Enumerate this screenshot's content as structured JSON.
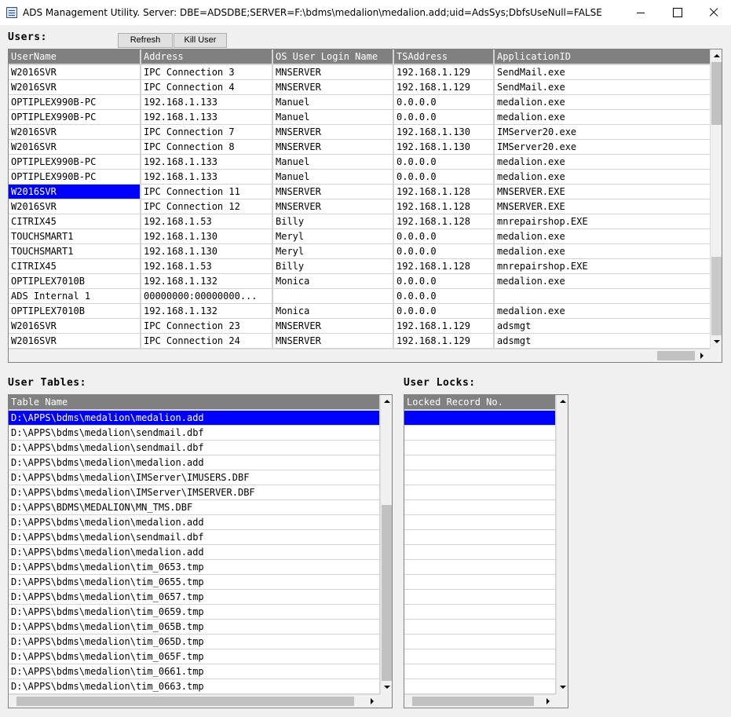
{
  "window": {
    "title": "ADS Management Utility. Server: DBE=ADSDBE;SERVER=F:\\bdms\\medalion\\medalion.add;uid=AdsSys;DbfsUseNull=FALSE"
  },
  "users": {
    "label": "Users:",
    "refresh_label": "Refresh",
    "kill_label": "Kill User",
    "columns": [
      "UserName",
      "Address",
      "OS User Login Name",
      "TSAddress",
      "ApplicationID"
    ],
    "selected_row": 7,
    "rows": [
      [
        "W2016SVR",
        "IPC Connection 3",
        "MNSERVER",
        "192.168.1.129",
        "SendMail.exe"
      ],
      [
        "W2016SVR",
        "IPC Connection 4",
        "MNSERVER",
        "192.168.1.129",
        "SendMail.exe"
      ],
      [
        "OPTIPLEX990B-PC",
        "192.168.1.133",
        "Manuel",
        "0.0.0.0",
        "medalion.exe"
      ],
      [
        "OPTIPLEX990B-PC",
        "192.168.1.133",
        "Manuel",
        "0.0.0.0",
        "medalion.exe"
      ],
      [
        "W2016SVR",
        "IPC Connection 7",
        "MNSERVER",
        "192.168.1.130",
        "IMServer20.exe"
      ],
      [
        "W2016SVR",
        "IPC Connection 8",
        "MNSERVER",
        "192.168.1.130",
        "IMServer20.exe"
      ],
      [
        "OPTIPLEX990B-PC",
        "192.168.1.133",
        "Manuel",
        "0.0.0.0",
        "medalion.exe"
      ],
      [
        "OPTIPLEX990B-PC",
        "192.168.1.133",
        "Manuel",
        "0.0.0.0",
        "medalion.exe"
      ],
      [
        "W2016SVR",
        "IPC Connection 11",
        "MNSERVER",
        "192.168.1.128",
        "MNSERVER.EXE"
      ],
      [
        "W2016SVR",
        "IPC Connection 12",
        "MNSERVER",
        "192.168.1.128",
        "MNSERVER.EXE"
      ],
      [
        "CITRIX45",
        "192.168.1.53",
        "Billy",
        "192.168.1.128",
        "mnrepairshop.EXE"
      ],
      [
        "TOUCHSMART1",
        "192.168.1.130",
        "Meryl",
        "0.0.0.0",
        "medalion.exe"
      ],
      [
        "TOUCHSMART1",
        "192.168.1.130",
        "Meryl",
        "0.0.0.0",
        "medalion.exe"
      ],
      [
        "CITRIX45",
        "192.168.1.53",
        "Billy",
        "192.168.1.128",
        "mnrepairshop.EXE"
      ],
      [
        "OPTIPLEX7010B",
        "192.168.1.132",
        "Monica",
        "0.0.0.0",
        "medalion.exe"
      ],
      [
        "ADS Internal 1",
        "00000000:00000000...",
        "",
        "0.0.0.0",
        ""
      ],
      [
        "OPTIPLEX7010B",
        "192.168.1.132",
        "Monica",
        "0.0.0.0",
        "medalion.exe"
      ],
      [
        "W2016SVR",
        "IPC Connection 23",
        "MNSERVER",
        "192.168.1.129",
        "adsmgt"
      ],
      [
        "W2016SVR",
        "IPC Connection 24",
        "MNSERVER",
        "192.168.1.129",
        "adsmgt"
      ]
    ]
  },
  "tables": {
    "label": "User Tables:",
    "column": "Table Name",
    "rows": [
      "D:\\APPS\\bdms\\medalion\\medalion.add",
      "D:\\APPS\\bdms\\medalion\\sendmail.dbf",
      "D:\\APPS\\bdms\\medalion\\sendmail.dbf",
      "D:\\APPS\\bdms\\medalion\\medalion.add",
      "D:\\APPS\\bdms\\medalion\\IMServer\\IMUSERS.DBF",
      "D:\\APPS\\bdms\\medalion\\IMServer\\IMSERVER.DBF",
      "D:\\APPS\\BDMS\\MEDALION\\MN_TMS.DBF",
      "D:\\APPS\\bdms\\medalion\\medalion.add",
      "D:\\APPS\\bdms\\medalion\\sendmail.dbf",
      "D:\\APPS\\bdms\\medalion\\medalion.add",
      "D:\\APPS\\bdms\\medalion\\tim_0653.tmp",
      "D:\\APPS\\bdms\\medalion\\tim_0655.tmp",
      "D:\\APPS\\bdms\\medalion\\tim_0657.tmp",
      "D:\\APPS\\bdms\\medalion\\tim_0659.tmp",
      "D:\\APPS\\bdms\\medalion\\tim_065B.tmp",
      "D:\\APPS\\bdms\\medalion\\tim_065D.tmp",
      "D:\\APPS\\bdms\\medalion\\tim_065F.tmp",
      "D:\\APPS\\bdms\\medalion\\tim_0661.tmp",
      "D:\\APPS\\bdms\\medalion\\tim_0663.tmp"
    ]
  },
  "locks": {
    "label": "User Locks:",
    "column": "Locked Record No."
  },
  "colors": {
    "selection": "#0000ff",
    "header": "#808080",
    "grid_line": "#d4d4d4"
  }
}
